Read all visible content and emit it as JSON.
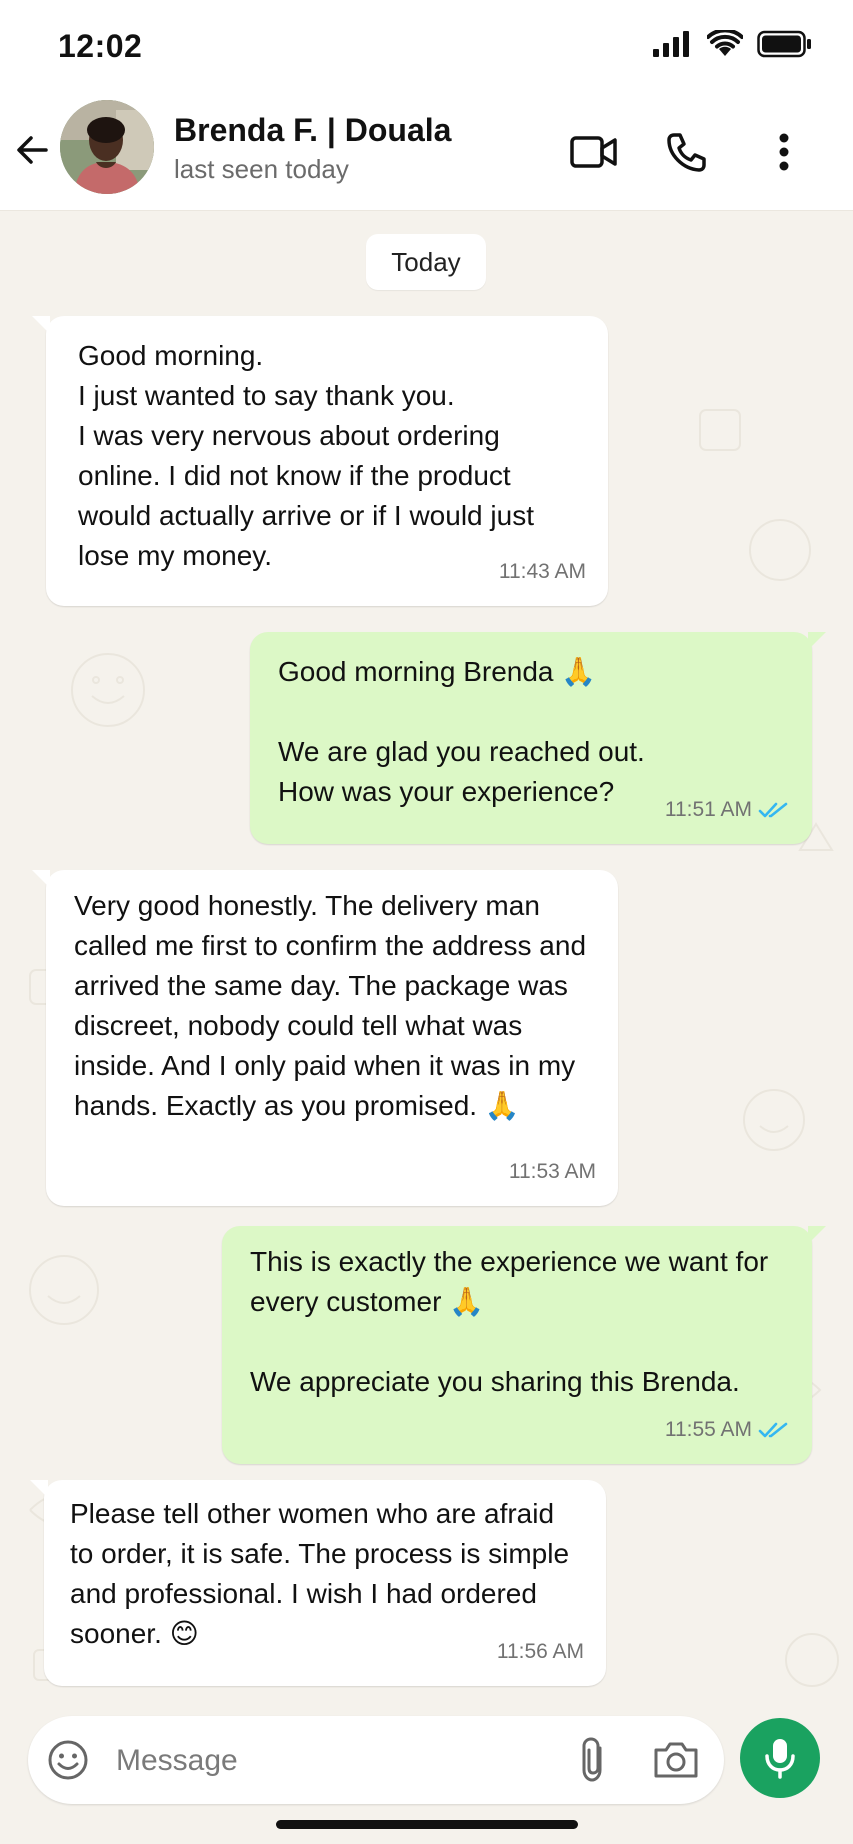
{
  "status_bar": {
    "time": "12:02"
  },
  "header": {
    "back_icon": "arrow-left-icon",
    "contact_name": "Brenda F. | Douala",
    "contact_status": "last seen today",
    "video_icon": "video-camera-icon",
    "call_icon": "phone-icon",
    "menu_icon": "more-vertical-icon"
  },
  "chat": {
    "date_chip": "Today",
    "messages": [
      {
        "direction": "in",
        "text": "Good morning.\nI just wanted to say thank you.\nI was very nervous about ordering online. I did not know if the product would actually arrive or if I would just lose my money.",
        "time": "11:43 AM"
      },
      {
        "direction": "out",
        "text": "Good morning Brenda 🙏\n\nWe are glad you reached out.\nHow was your experience?",
        "time": "11:51 AM",
        "read": true
      },
      {
        "direction": "in",
        "text": "Very good honestly. The delivery man called me first to confirm the address and arrived the same day. The package was discreet, nobody could tell what was inside. And I only paid when it was in my hands. Exactly as you promised. 🙏",
        "time": "11:53 AM"
      },
      {
        "direction": "out",
        "text": "This is exactly the experience we want for every customer 🙏\n\nWe appreciate you sharing this Brenda.",
        "time": "11:55 AM",
        "read": true
      },
      {
        "direction": "in",
        "text": "Please tell other women who are afraid to order, it is safe. The process is simple and professional. I wish I had ordered sooner. 😊",
        "time": "11:56 AM"
      }
    ]
  },
  "composer": {
    "placeholder": "Message",
    "emoji_icon": "emoji-icon",
    "attach_icon": "paperclip-icon",
    "camera_icon": "camera-icon",
    "mic_icon": "microphone-icon"
  },
  "colors": {
    "incoming_bubble": "#ffffff",
    "outgoing_bubble": "#dcf8c6",
    "chat_background": "#f5f2ec",
    "read_ticks": "#34b7f1",
    "mic_button": "#1aa260"
  }
}
